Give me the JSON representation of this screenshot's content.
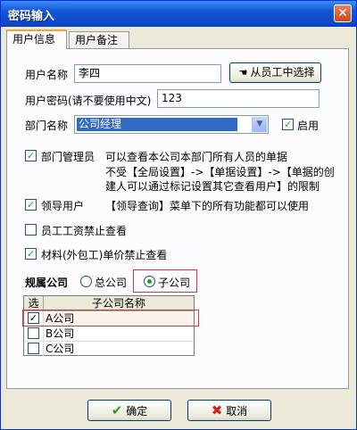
{
  "window": {
    "title": "密码输入",
    "close_glyph": "✕"
  },
  "tabs": [
    {
      "label": "用户信息",
      "active": true
    },
    {
      "label": "用户备注",
      "active": false
    }
  ],
  "form": {
    "username_label": "用户名称",
    "username_value": "李四",
    "select_employee_button": "从员工中选择",
    "password_label": "用户密码(请不要使用中文)",
    "password_value": "123",
    "department_label": "部门名称",
    "department_value": "公司经理",
    "enable_label": "启用",
    "enable_checked": true
  },
  "options": {
    "dept_manager_label": "部门管理员",
    "dept_manager_checked": true,
    "dept_manager_desc1": "可以查看本公司本部门所有人员的单据",
    "dept_manager_desc2": "不受【全局设置】->【单据设置】->【单据的创",
    "dept_manager_desc3": "建人可以通过标记设置其它查看用户】的限制",
    "leader_label": "领导用户",
    "leader_checked": true,
    "leader_desc": "【领导查询】菜单下的所有功能都可以使用",
    "salary_label": "员工工资禁止查看",
    "salary_checked": false,
    "material_label": "材料(外包工)单价禁止查看",
    "material_checked": true
  },
  "company": {
    "label": "规属公司",
    "head_office": "总公司",
    "subsidiary": "子公司",
    "selected": "子公司"
  },
  "grid": {
    "col_select": "选",
    "col_name": "子公司名称",
    "rows": [
      {
        "name": "A公司",
        "checked": true
      },
      {
        "name": "B公司",
        "checked": false
      },
      {
        "name": "C公司",
        "checked": false
      }
    ]
  },
  "buttons": {
    "ok": "确定",
    "cancel": "取消"
  },
  "colors": {
    "title_bar": "#1458d8",
    "selection": "#316ac5",
    "highlight_border": "#d23a3a",
    "check": "#21a121",
    "cancel_x": "#c8261c"
  }
}
